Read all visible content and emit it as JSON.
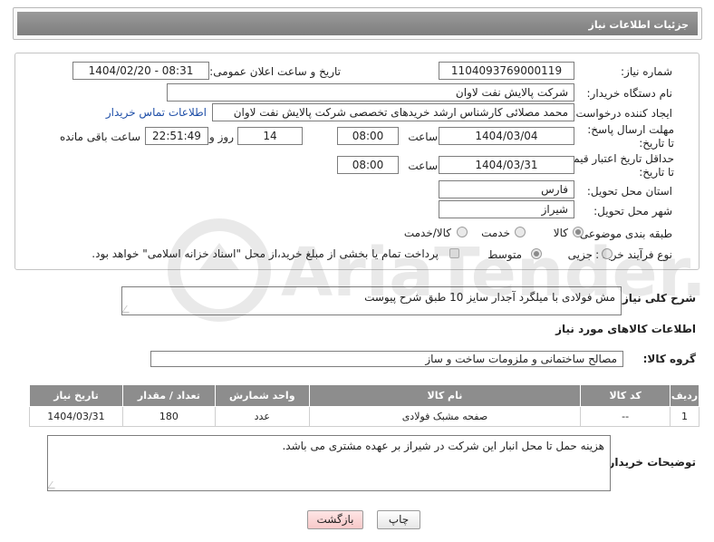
{
  "header": {
    "title": "جزئیات اطلاعات نیاز"
  },
  "form": {
    "need_number_label": "شماره نیاز:",
    "need_number": "1104093769000119",
    "announce_label": "تاریخ و ساعت اعلان عمومی:",
    "announce_value": "1404/02/20 - 08:31",
    "buyer_org_label": "نام دستگاه خریدار:",
    "buyer_org": "شرکت پالایش نفت لاوان",
    "creator_label": "ایجاد کننده درخواست:",
    "creator": "محمد مصلائی کارشناس ارشد خریدهای تخصصی شرکت پالایش نفت لاوان",
    "contact_link": "اطلاعات تماس خریدار",
    "reply_deadline_label": "مهلت ارسال پاسخ: تا تاریخ:",
    "reply_date": "1404/03/04",
    "time_label": "ساعت",
    "reply_time": "08:00",
    "days_value": "14",
    "days_label": "روز و",
    "remaining_time": "22:51:49",
    "remaining_label": "ساعت باقی مانده",
    "price_validity_label": "حداقل تاریخ اعتبار قیمت: تا تاریخ:",
    "price_date": "1404/03/31",
    "price_time": "08:00",
    "province_label": "استان محل تحویل:",
    "province": "فارس",
    "city_label": "شهر محل تحویل:",
    "city": "شیراز",
    "category_label": "طبقه بندی موضوعی:",
    "category_options": [
      "کالا",
      "خدمت",
      "کالا/خدمت"
    ],
    "category_selected": "کالا",
    "process_label": "نوع فرآیند خرید :",
    "process_options": [
      "جزیی",
      "متوسط"
    ],
    "process_selected": "متوسط",
    "payment_note": "پرداخت تمام یا بخشی از مبلغ خرید،از محل \"اسناد خزانه اسلامی\" خواهد بود."
  },
  "description": {
    "label": "شرح کلی نیاز:",
    "text": "مش فولادی با میلگرد آجدار سایز 10 طبق شرح پیوست"
  },
  "goods": {
    "section_title": "اطلاعات کالاهای مورد نیاز",
    "group_label": "گروه کالا:",
    "group_value": "مصالح ساختمانی و ملزومات ساخت و ساز",
    "columns": [
      "ردیف",
      "کد کالا",
      "نام کالا",
      "واحد شمارش",
      "تعداد / مقدار",
      "تاریخ نیاز"
    ],
    "rows": [
      [
        "1",
        "--",
        "صفحه مشبک فولادی",
        "عدد",
        "180",
        "1404/03/31"
      ]
    ]
  },
  "buyer_notes": {
    "label": "توضیحات خریدار:",
    "text": "هزینه حمل تا محل انبار این شرکت در شیراز بر عهده مشتری می باشد."
  },
  "buttons": {
    "print": "چاپ",
    "back": "بازگشت"
  },
  "watermark_text": "AriaTender.net"
}
